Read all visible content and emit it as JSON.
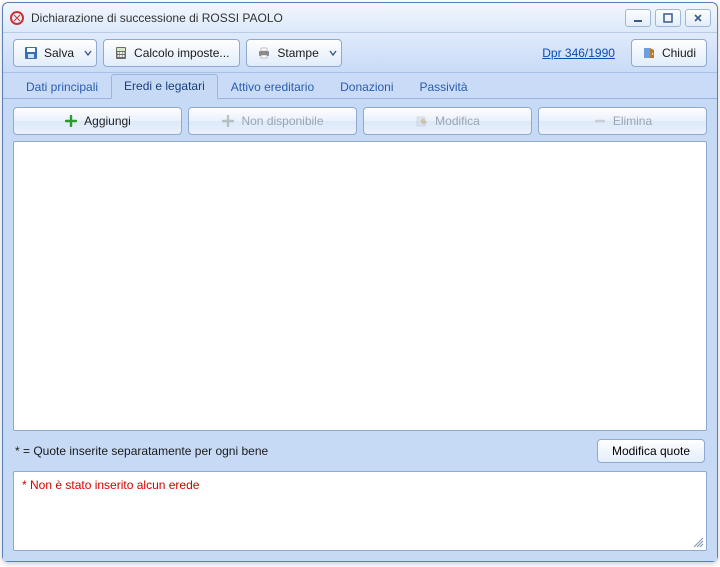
{
  "window": {
    "title": "Dichiarazione di successione di ROSSI PAOLO"
  },
  "toolbar": {
    "save_label": "Salva",
    "calc_label": "Calcolo imposte...",
    "print_label": "Stampe",
    "link_label": "Dpr 346/1990",
    "close_label": "Chiudi"
  },
  "tabs": [
    {
      "label": "Dati principali",
      "active": false
    },
    {
      "label": "Eredi e legatari",
      "active": true
    },
    {
      "label": "Attivo ereditario",
      "active": false
    },
    {
      "label": "Donazioni",
      "active": false
    },
    {
      "label": "Passività",
      "active": false
    }
  ],
  "actions": {
    "add": "Aggiungi",
    "not_available": "Non disponibile",
    "edit": "Modifica",
    "delete": "Elimina"
  },
  "footnote": "* = Quote inserite separatamente per ogni bene",
  "modify_quotes": "Modifica quote",
  "message": "* Non è stato inserito alcun erede"
}
